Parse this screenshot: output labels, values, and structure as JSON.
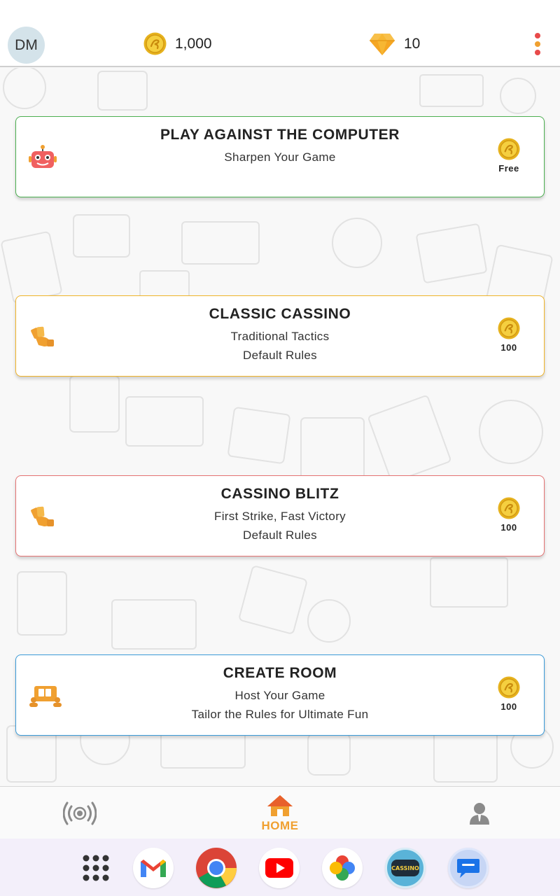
{
  "header": {
    "avatar_initials": "DM",
    "coins": "1,000",
    "gems": "10",
    "coin_icon": "coin-icon",
    "gem_icon": "diamond-icon",
    "menu_icon": "kebab-menu-icon",
    "menu_dot_colors": [
      "#e84a4a",
      "#f0a030",
      "#e84a4a"
    ]
  },
  "modes": [
    {
      "title": "PLAY AGAINST THE COMPUTER",
      "lines": [
        "Sharpen Your Game"
      ],
      "cost": "Free",
      "icon": "robot-icon",
      "border_color": "#4caf50"
    },
    {
      "title": "CLASSIC CASSINO",
      "lines": [
        "Traditional Tactics",
        "Default Rules"
      ],
      "cost": "100",
      "icon": "playing-cards-hand-icon",
      "border_color": "#f0b429"
    },
    {
      "title": "CASSINO BLITZ",
      "lines": [
        "First Strike, Fast Victory",
        "Default Rules"
      ],
      "cost": "100",
      "icon": "playing-cards-hand-icon",
      "border_color": "#e57373"
    },
    {
      "title": "CREATE ROOM",
      "lines": [
        "Host Your Game",
        "Tailor the Rules for Ultimate Fun"
      ],
      "cost": "100",
      "icon": "card-table-players-icon",
      "border_color": "#3a9bd8"
    }
  ],
  "bottom_nav": {
    "left_icon": "broadcast-icon",
    "home_label": "HOME",
    "home_icon": "home-icon",
    "right_icon": "profile-icon",
    "active_color": "#f0a030"
  },
  "dock": {
    "apps": [
      "app-drawer-icon",
      "gmail-icon",
      "chrome-icon",
      "youtube-icon",
      "photos-icon",
      "cassino-app-icon",
      "messages-icon"
    ],
    "cassino_badge": "CASSINO"
  }
}
